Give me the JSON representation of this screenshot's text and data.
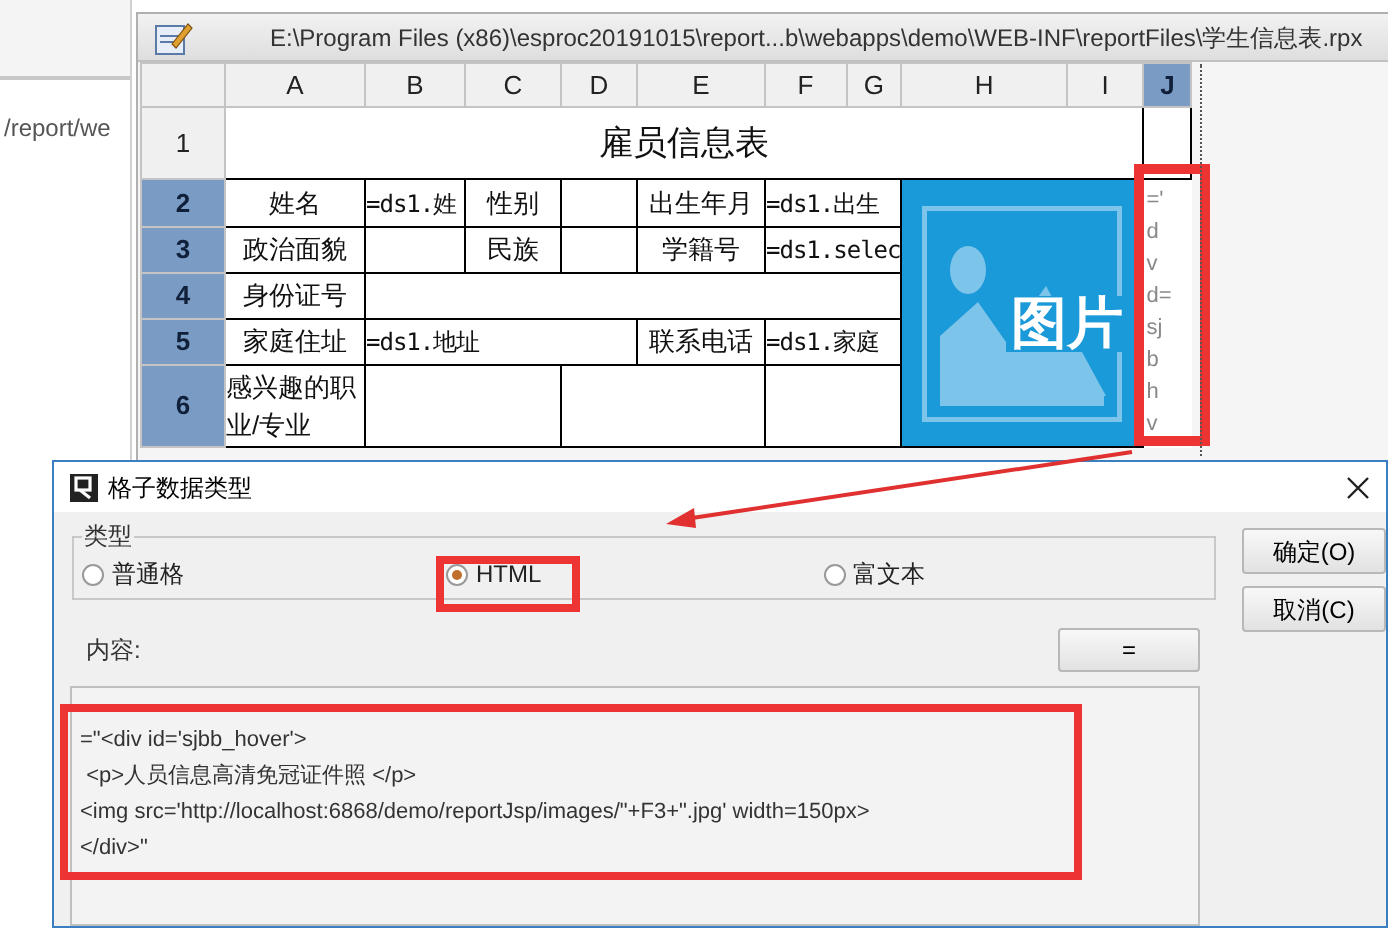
{
  "background_window": {
    "path_fragment": "/report/we"
  },
  "editor": {
    "title": "E:\\Program Files (x86)\\esproc20191015\\report...b\\webapps\\demo\\WEB-INF\\reportFiles\\学生信息表.rpx",
    "columns": [
      {
        "label": "A",
        "selected": false
      },
      {
        "label": "B",
        "selected": false
      },
      {
        "label": "C",
        "selected": false
      },
      {
        "label": "D",
        "selected": false
      },
      {
        "label": "E",
        "selected": false
      },
      {
        "label": "F",
        "selected": false
      },
      {
        "label": "G",
        "selected": false
      },
      {
        "label": "H",
        "selected": false
      },
      {
        "label": "I",
        "selected": false
      },
      {
        "label": "J",
        "selected": true
      }
    ],
    "rows": [
      {
        "label": "1",
        "selected": false,
        "cells": [
          {
            "kind": "title",
            "text": "雇员信息表",
            "colspan": 9
          },
          {
            "kind": "empty"
          }
        ]
      },
      {
        "label": "2",
        "selected": true,
        "cells": [
          {
            "kind": "label",
            "text": "姓名"
          },
          {
            "kind": "formula",
            "text": "=ds1.姓"
          },
          {
            "kind": "label",
            "text": "性别"
          },
          {
            "kind": "empty"
          },
          {
            "kind": "label",
            "text": "出生年月"
          },
          {
            "kind": "formula",
            "text": "=ds1.出生",
            "colspan": 2
          },
          {
            "kind": "picture",
            "text": "图片",
            "colspan": 2,
            "rowspan": 5
          },
          {
            "kind": "clipped",
            "lines": [
              "='",
              "d",
              "v",
              "d=",
              "sj",
              "b",
              "h",
              "v"
            ],
            "rowspan": 5
          }
        ]
      },
      {
        "label": "3",
        "selected": true,
        "cells": [
          {
            "kind": "label",
            "text": "政治面貌"
          },
          {
            "kind": "empty"
          },
          {
            "kind": "label",
            "text": "民族"
          },
          {
            "kind": "empty"
          },
          {
            "kind": "label",
            "text": "学籍号"
          },
          {
            "kind": "formula",
            "text": "=ds1.selec",
            "colspan": 2
          }
        ]
      },
      {
        "label": "4",
        "selected": true,
        "cells": [
          {
            "kind": "label",
            "text": "身份证号"
          },
          {
            "kind": "empty",
            "colspan": 6
          }
        ]
      },
      {
        "label": "5",
        "selected": true,
        "cells": [
          {
            "kind": "label",
            "text": "家庭住址"
          },
          {
            "kind": "formula",
            "text": "=ds1.地址",
            "colspan": 3
          },
          {
            "kind": "label",
            "text": "联系电话"
          },
          {
            "kind": "formula",
            "text": "=ds1.家庭",
            "colspan": 2
          }
        ]
      },
      {
        "label": "6",
        "selected": true,
        "cells": [
          {
            "kind": "note",
            "text": "感兴趣的职业/专业"
          },
          {
            "kind": "empty",
            "colspan": 2
          },
          {
            "kind": "empty",
            "colspan": 2
          },
          {
            "kind": "empty",
            "colspan": 2
          }
        ]
      }
    ]
  },
  "dialog": {
    "title": "格子数据类型",
    "group_label": "类型",
    "radios": [
      {
        "label": "普通格",
        "selected": false
      },
      {
        "label": "HTML",
        "selected": true
      },
      {
        "label": "富文本",
        "selected": false
      }
    ],
    "buttons": [
      "确定(O)",
      "取消(C)"
    ],
    "content_label": "内容:",
    "formula_button": "=",
    "content_lines": [
      "=\"<div id='sjbb_hover'>",
      " <p>人员信息高清免冠证件照 </p>",
      "<img src='http://localhost:6868/demo/reportJsp/images/\"+F3+\".jpg' width=150px>",
      "</div>\""
    ]
  }
}
